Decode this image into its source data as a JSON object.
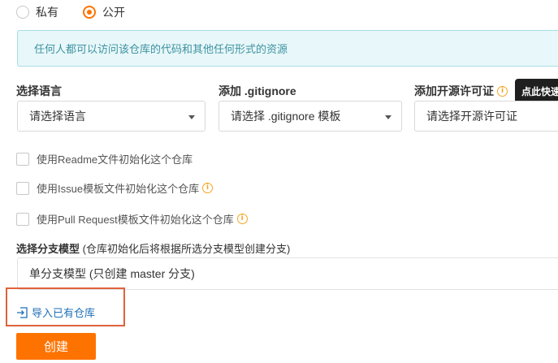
{
  "visibility": {
    "options": [
      {
        "label": "私有",
        "checked": false
      },
      {
        "label": "公开",
        "checked": true
      }
    ],
    "info_text": "任何人都可以访问该仓库的代码和其他任何形式的资源"
  },
  "language": {
    "label": "选择语言",
    "placeholder": "请选择语言"
  },
  "gitignore": {
    "label": "添加 .gitignore",
    "placeholder": "请选择 .gitignore 模板"
  },
  "license": {
    "label": "添加开源许可证",
    "placeholder": "请选择开源许可证",
    "tooltip": "点此快速"
  },
  "init_options": [
    {
      "label": "使用Readme文件初始化这个仓库",
      "checked": false,
      "info": false
    },
    {
      "label": "使用Issue模板文件初始化这个仓库",
      "checked": false,
      "info": true
    },
    {
      "label": "使用Pull Request模板文件初始化这个仓库",
      "checked": false,
      "info": true
    }
  ],
  "branch": {
    "label_bold": "选择分支模型",
    "label_note": " (仓库初始化后将根据所选分支模型创建分支)",
    "selected": "单分支模型 (只创建 master 分支)"
  },
  "import_link": "导入已有仓库",
  "create_button": "创建",
  "colors": {
    "accent": "#fe7300",
    "info_bg": "#e8f7f9",
    "info_text": "#3d93a2",
    "link": "#1f6fb5",
    "highlight_border": "#e0623c",
    "warning_icon": "#f5a623"
  },
  "icons": {
    "info": "info-circle-icon",
    "caret": "caret-down-icon",
    "import": "import-icon"
  }
}
